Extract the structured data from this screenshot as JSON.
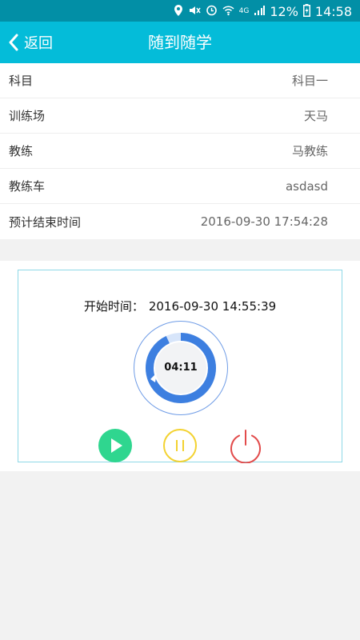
{
  "status_bar": {
    "icons": [
      "location-icon",
      "mute-icon",
      "alarm-icon",
      "wifi-icon",
      "4g-icon",
      "signal-icon",
      "battery-icon"
    ],
    "network_label": "4G",
    "battery": "12%",
    "time": "14:58"
  },
  "nav": {
    "back_label": "返回",
    "title": "随到随学"
  },
  "info": {
    "rows": [
      {
        "label": "科目",
        "value": "科目一"
      },
      {
        "label": "训练场",
        "value": "天马"
      },
      {
        "label": "教练",
        "value": "马教练"
      },
      {
        "label": "教练车",
        "value": "asdasd"
      },
      {
        "label": "预计结束时间",
        "value": "2016-09-30 17:54:28"
      }
    ]
  },
  "timer": {
    "start_label": "开始时间：",
    "start_time": "2016-09-30 14:55:39",
    "elapsed": "04:11",
    "progress": 0.93,
    "colors": {
      "ring": "#3d7fe0",
      "play": "#2fd68f",
      "pause": "#f3d230",
      "stop": "#e24b4b"
    }
  }
}
